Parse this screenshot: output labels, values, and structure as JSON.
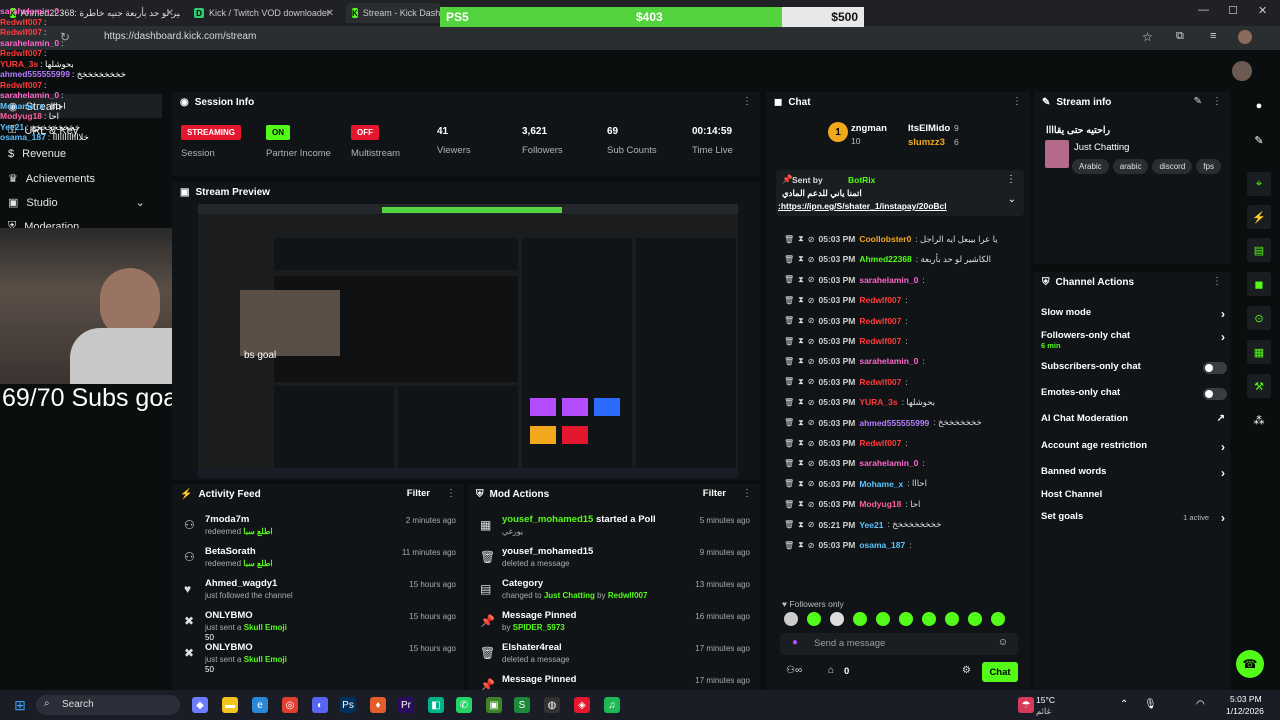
{
  "browser": {
    "tabs": [
      {
        "label": "Ahmed22368: الكاشير لو حد بأربعة جنيه خاطرة"
      },
      {
        "label": "Kick / Twitch VOD downloader"
      },
      {
        "label": "Stream - Kick Dashboard"
      }
    ],
    "url": "https://dashboard.kick.com/stream"
  },
  "goal_bar": {
    "label": "PS5",
    "current": "$403",
    "target": "$500",
    "progress": 0.806
  },
  "overlay_chat": [
    {
      "user": "sarahelamin_0",
      "msg": ":"
    },
    {
      "user": "Redwlf007",
      "msg": ":"
    },
    {
      "user": "Redwlf007",
      "msg": ":"
    },
    {
      "user": "sarahelamin_0",
      "msg": ":"
    },
    {
      "user": "Redwlf007",
      "msg": ":"
    },
    {
      "user": "YURA_3s",
      "msg": ": بحوشلها"
    },
    {
      "user": "ahmed555555999",
      "msg": ": خخخخخخخخخ"
    },
    {
      "user": "Redwlf007",
      "msg": ":"
    },
    {
      "user": "sarahelamin_0",
      "msg": ":"
    },
    {
      "user": "Mohame_x",
      "msg": ": احااا"
    },
    {
      "user": "Modyug18",
      "msg": ": احا"
    },
    {
      "user": "Yee21",
      "msg": ": خخخخخخخخخ"
    },
    {
      "user": "osama_187",
      "msg": ": خلاااااااااااا"
    }
  ],
  "left_nav": {
    "items": [
      {
        "label": "Stream"
      },
      {
        "label": "URL & Key"
      },
      {
        "label": "Revenue"
      },
      {
        "label": "Achievements"
      },
      {
        "label": "Studio"
      },
      {
        "label": "Moderation"
      }
    ]
  },
  "subs_goal": "69/70 Subs goal",
  "cam_overlay": "bs goal",
  "session": {
    "title": "Session Info",
    "stats": [
      {
        "badge": "STREAMING",
        "label": "Session"
      },
      {
        "badge": "ON",
        "label": "Partner Income"
      },
      {
        "badge": "OFF",
        "label": "Multistream"
      },
      {
        "value": "41",
        "label": "Viewers"
      },
      {
        "value": "3,621",
        "label": "Followers"
      },
      {
        "value": "69",
        "label": "Sub Counts"
      },
      {
        "value": "00:14:59",
        "label": "Time Live"
      }
    ]
  },
  "preview": {
    "title": "Stream Preview"
  },
  "activity": {
    "title": "Activity Feed",
    "filter": "Filter",
    "items": [
      {
        "icon": "users-icon",
        "name": "7moda7m",
        "desc_prefix": "redeemed",
        "desc_highlight": "اطلع سبا",
        "time": "2 minutes ago"
      },
      {
        "icon": "users-icon",
        "name": "BetaSorath",
        "desc_prefix": "redeemed",
        "desc_highlight": "اطلع سبا",
        "time": "11 minutes ago"
      },
      {
        "icon": "heart-icon",
        "name": "Ahmed_wagdy1",
        "desc_prefix": "just followed the channel",
        "desc_highlight": "",
        "time": "15 hours ago"
      },
      {
        "icon": "close-icon",
        "name": "ONLYBMO",
        "desc_prefix": "just sent a",
        "desc_highlight": "Skull Emoji",
        "extra": "50",
        "time": "15 hours ago"
      },
      {
        "icon": "close-icon",
        "name": "ONLYBMO",
        "desc_prefix": "just sent a",
        "desc_highlight": "Skull Emoji",
        "extra": "50",
        "time": "15 hours ago"
      }
    ]
  },
  "mod_actions": {
    "title": "Mod Actions",
    "filter": "Filter",
    "items": [
      {
        "name": "yousef_mohamed15",
        "name_rest": "started a Poll",
        "desc": "يورغي",
        "time": "5 minutes ago"
      },
      {
        "name": "yousef_mohamed15",
        "name_rest": "",
        "desc": "deleted a message",
        "time": "9 minutes ago"
      },
      {
        "name": "Category",
        "name_rest": "",
        "desc_prefix": "changed to",
        "desc_a": "Just Chatting",
        "desc_mid": "by",
        "desc_b": "Redwlf007",
        "time": "13 minutes ago"
      },
      {
        "name": "Message Pinned",
        "name_rest": "",
        "desc_prefix": "by",
        "desc_a": "SPIDER_5973",
        "time": "16 minutes ago"
      },
      {
        "name": "Elshater4real",
        "name_rest": "",
        "desc": "deleted a message",
        "time": "17 minutes ago"
      },
      {
        "name": "Message Pinned",
        "name_rest": "",
        "desc": "",
        "time": "17 minutes ago"
      }
    ]
  },
  "chat": {
    "title": "Chat",
    "leaders": [
      {
        "name": "zngman",
        "count": "10"
      },
      {
        "name": "ItsElMido",
        "count": "9"
      },
      {
        "name": "slumzz3",
        "count": "6"
      }
    ],
    "pinned": {
      "sent_by": "Sent by",
      "bot": "BotRix",
      "text": "اتمنا ياني للدعم المادي",
      "link": ":https://ipn.eg/S/shater_1/instapay/20oBcl"
    },
    "messages": [
      {
        "time": "05:03 PM",
        "user": "Coollobster0",
        "color": "#f5a623",
        "msg": ": يا عرا بيبعل ايه الراجل"
      },
      {
        "time": "05:03 PM",
        "user": "Ahmed22368",
        "color": "#53fc18",
        "msg": ": الكاشير لو حد بأربعة"
      },
      {
        "time": "05:03 PM",
        "user": "sarahelamin_0",
        "color": "#ff66cc",
        "msg": ":"
      },
      {
        "time": "05:03 PM",
        "user": "Redwlf007",
        "color": "#ff3b3b",
        "msg": ":"
      },
      {
        "time": "05:03 PM",
        "user": "Redwlf007",
        "color": "#ff3b3b",
        "msg": ":"
      },
      {
        "time": "05:03 PM",
        "user": "Redwlf007",
        "color": "#ff3b3b",
        "msg": ":"
      },
      {
        "time": "05:03 PM",
        "user": "sarahelamin_0",
        "color": "#ff66cc",
        "msg": ":"
      },
      {
        "time": "05:03 PM",
        "user": "Redwlf007",
        "color": "#ff3b3b",
        "msg": ":"
      },
      {
        "time": "05:03 PM",
        "user": "YURA_3s",
        "color": "#ff3b3b",
        "msg": ": بحوشلها"
      },
      {
        "time": "05:03 PM",
        "user": "ahmed555555999",
        "color": "#b57cff",
        "msg": ": خخخخخخخخ"
      },
      {
        "time": "05:03 PM",
        "user": "Redwlf007",
        "color": "#ff3b3b",
        "msg": ":"
      },
      {
        "time": "05:03 PM",
        "user": "sarahelamin_0",
        "color": "#ff66cc",
        "msg": ":"
      },
      {
        "time": "05:03 PM",
        "user": "Mohame_x",
        "color": "#59c4ff",
        "msg": ": احااا"
      },
      {
        "time": "05:03 PM",
        "user": "Modyug18",
        "color": "#ff5da2",
        "msg": ": احا"
      },
      {
        "time": "05:21 PM",
        "user": "Yee21",
        "color": "#59c4ff",
        "msg": ": خخخخخخخخخ"
      },
      {
        "time": "05:03 PM",
        "user": "osama_187",
        "color": "#59c4ff",
        "msg": ":"
      }
    ],
    "followers_only": "Followers only",
    "input_placeholder": "Send a message",
    "viewers": "0",
    "send_label": "Chat"
  },
  "stream_info": {
    "title": "Stream info",
    "stream_title": "راحتيه حتى يقاااا",
    "category": "Just Chatting",
    "tags": [
      "Arabic",
      "arabic",
      "discord",
      "fps"
    ]
  },
  "channel_actions": {
    "title": "Channel Actions",
    "items": [
      {
        "label": "Slow mode",
        "type": "arrow"
      },
      {
        "label": "Followers-only chat",
        "sub": "6 min",
        "type": "arrow"
      },
      {
        "label": "Subscribers-only chat",
        "type": "toggle"
      },
      {
        "label": "Emotes-only chat",
        "type": "toggle"
      },
      {
        "label": "AI Chat Moderation",
        "type": "link"
      },
      {
        "label": "Account age restriction",
        "type": "arrow"
      },
      {
        "label": "Banned words",
        "type": "arrow"
      },
      {
        "label": "Host Channel",
        "type": "none"
      },
      {
        "label": "Set goals",
        "sub_right": "1 active",
        "type": "arrow"
      }
    ]
  },
  "taskbar": {
    "search": "Search",
    "weather_temp": "15°C",
    "weather_desc": "غائم",
    "time": "5:03 PM",
    "date": "1/12/2026"
  },
  "colors": {
    "accent": "#53fc18",
    "streaming": "#e5172f",
    "on": "#53fc18",
    "off": "#e5172f"
  }
}
